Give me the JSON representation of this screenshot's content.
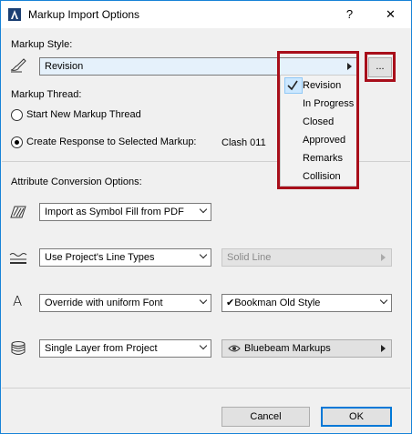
{
  "window": {
    "title": "Markup Import Options",
    "help_label": "?",
    "close_label": "✕"
  },
  "markup_style": {
    "label": "Markup Style:",
    "selected": "Revision",
    "browse_label": "...",
    "options": [
      "Revision",
      "In Progress",
      "Closed",
      "Approved",
      "Remarks",
      "Collision"
    ],
    "checked_option": "Revision"
  },
  "markup_thread": {
    "label": "Markup Thread:",
    "option_new": "Start New Markup Thread",
    "option_response": "Create Response to Selected Markup:",
    "response_target": "Clash 011",
    "selected": "Create Response to Selected Markup:"
  },
  "attribute_conversion": {
    "label": "Attribute Conversion Options:",
    "fill": {
      "icon": "fill-icon",
      "value": "Import as Symbol Fill from PDF"
    },
    "line": {
      "icon": "line-type-icon",
      "value": "Use Project's Line Types",
      "secondary": "Solid Line",
      "secondary_enabled": false
    },
    "font": {
      "icon": "font-icon",
      "icon_glyph": "A",
      "value": "Override with uniform Font",
      "secondary": "Bookman Old Style",
      "secondary_check": "✔"
    },
    "layer": {
      "icon": "layers-icon",
      "value": "Single Layer from Project",
      "secondary": "Bluebeam Markups",
      "secondary_icon": "eye-icon"
    }
  },
  "footer": {
    "cancel_label": "Cancel",
    "ok_label": "OK"
  },
  "highlight_color": "#a80e1a",
  "accent_color": "#0078d7"
}
